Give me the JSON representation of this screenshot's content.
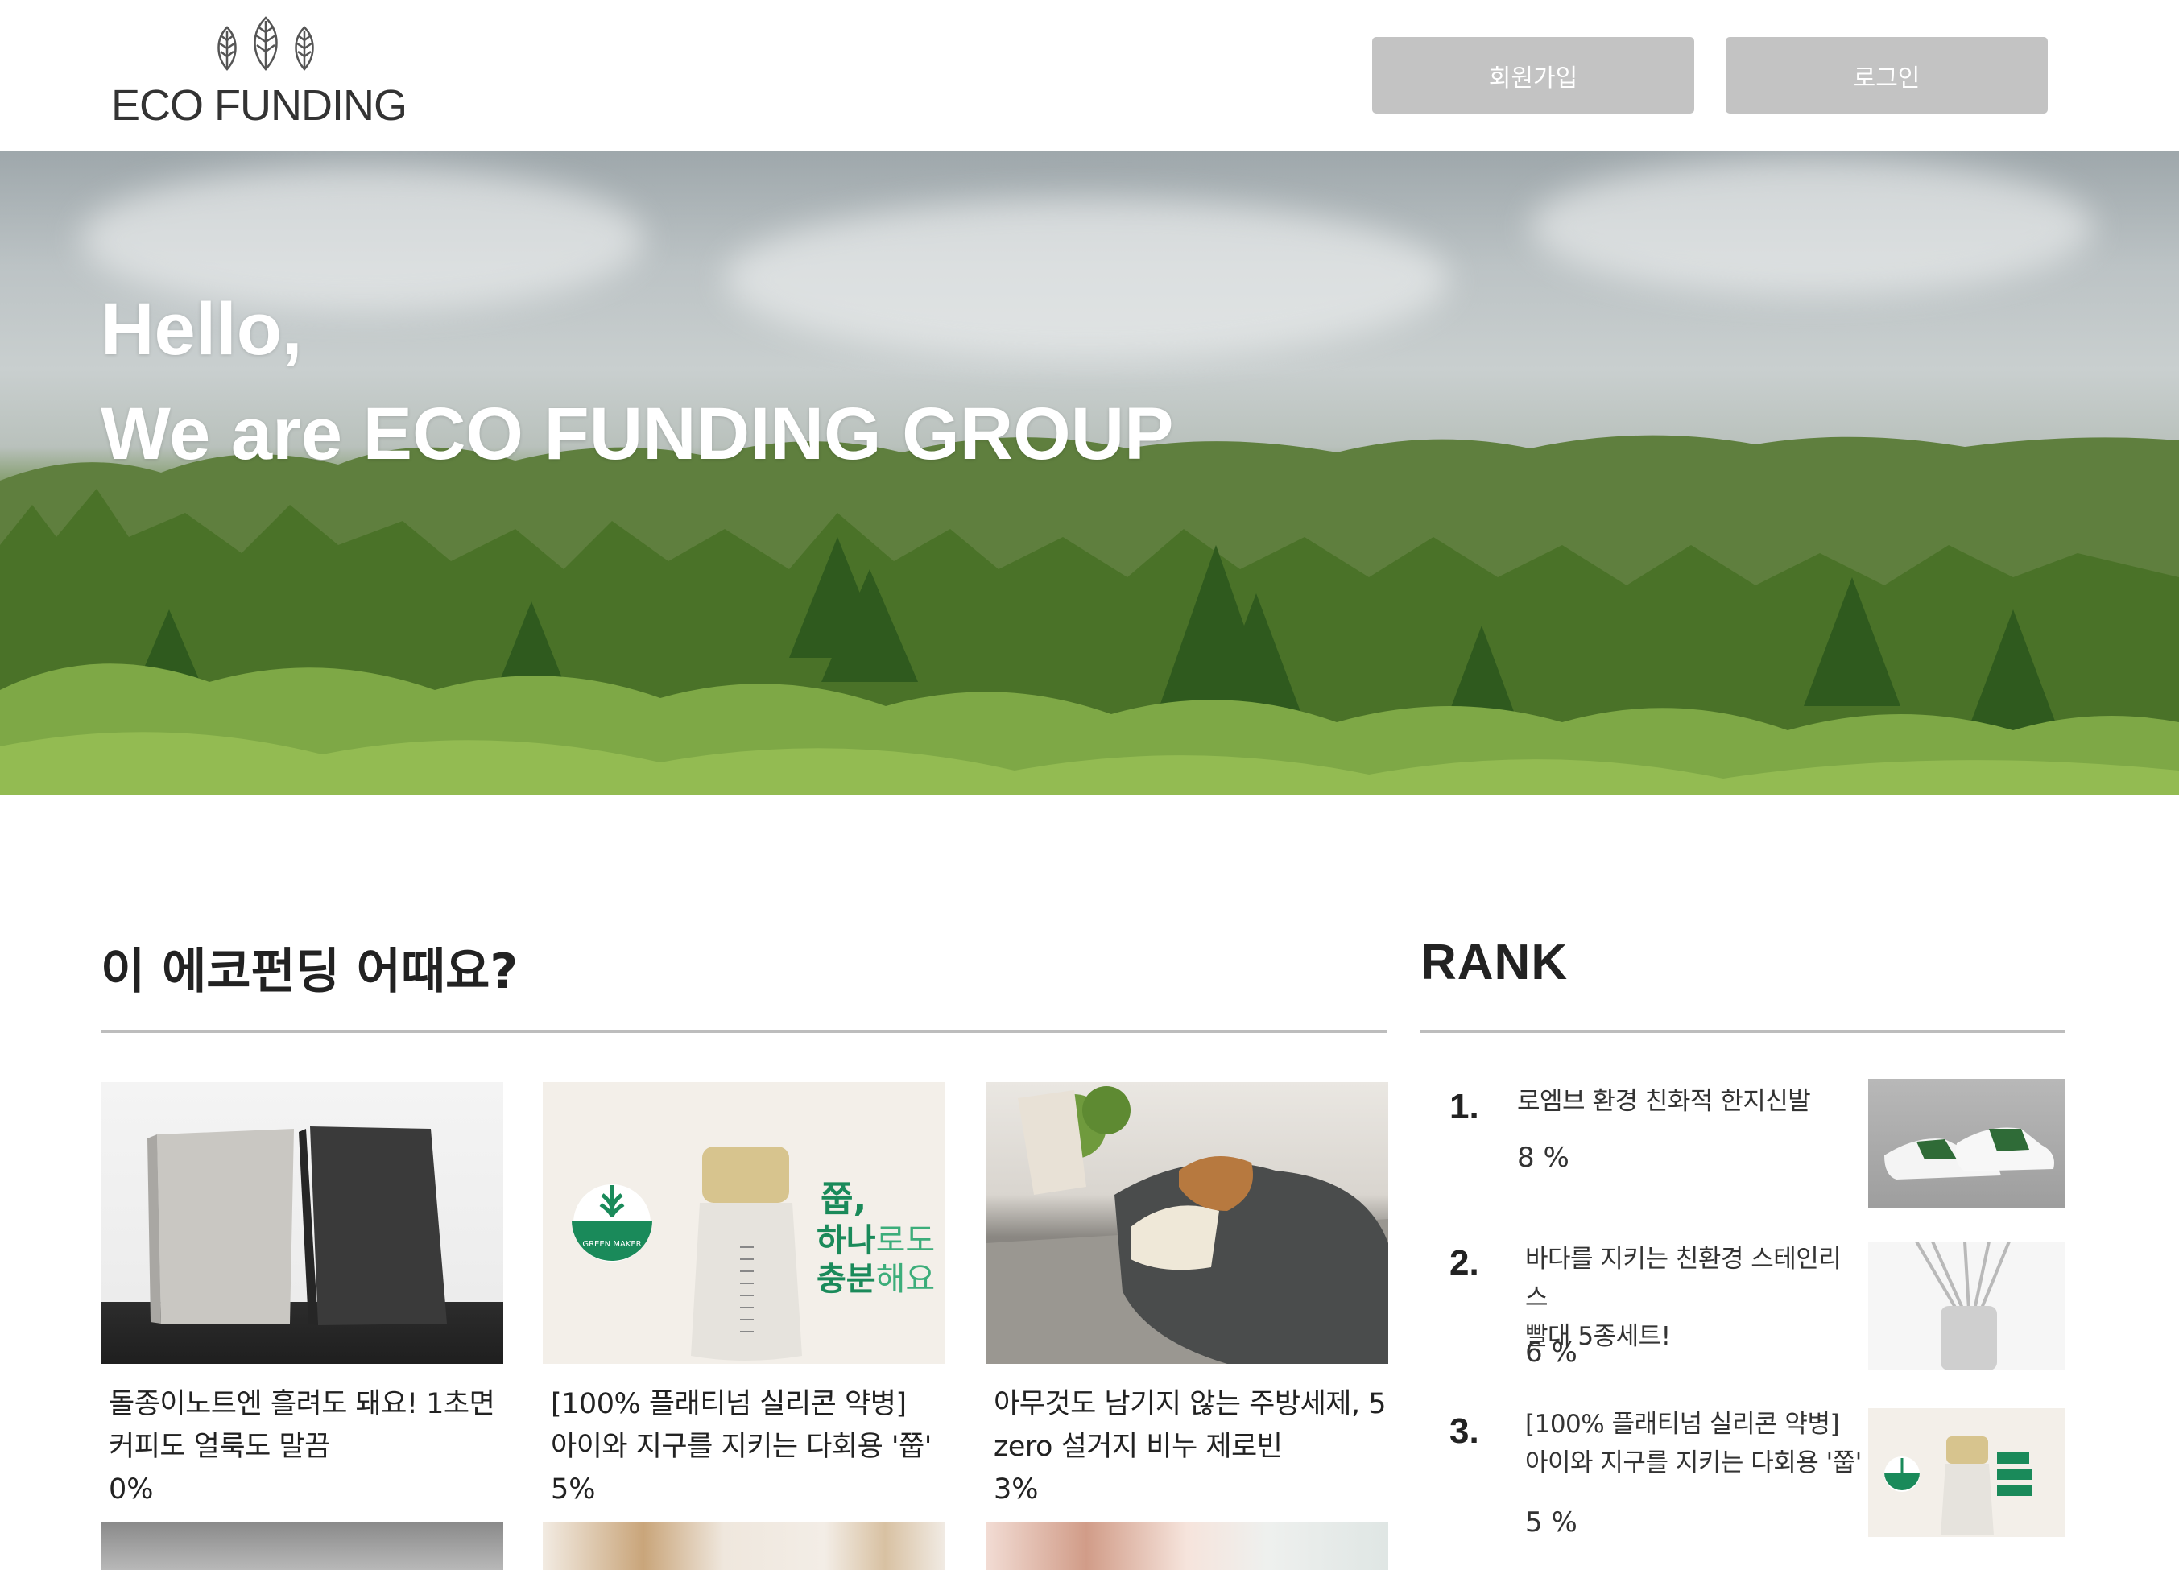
{
  "header": {
    "logo_text": "ECO FUNDING",
    "signup_label": "회원가입",
    "login_label": "로그인"
  },
  "hero": {
    "line1": "Hello,",
    "line2": "We are ECO FUNDING GROUP"
  },
  "recommend": {
    "title": "이 에코펀딩 어때요?",
    "cards": [
      {
        "title_line1": "돌종이노트엔 흘려도 돼요! 1초면",
        "title_line2": "커피도 얼룩도 말끔",
        "percent": "0%"
      },
      {
        "title_line1": "[100% 플래티넘 실리콘 약병]",
        "title_line2": "아이와 지구를 지키는 다회용 '쭙'",
        "percent": "5%"
      },
      {
        "title_line1": "아무것도 남기지 않는 주방세제, 5",
        "title_line2": "zero 설거지 비누 제로빈",
        "percent": "3%"
      }
    ],
    "bottle_badge": "GREEN MAKER",
    "bottle_slogan_line1": "쭙,",
    "bottle_slogan_line2a": "하나",
    "bottle_slogan_line2b": "로도",
    "bottle_slogan_line3a": "충분",
    "bottle_slogan_line3b": "해요"
  },
  "rank": {
    "title": "RANK",
    "items": [
      {
        "number": "1.",
        "title_line1": "로엠브 환경 친화적 한지신발",
        "title_line2": "",
        "percent": "8 %"
      },
      {
        "number": "2.",
        "title_line1": "바다를 지키는 친환경 스테인리스",
        "title_line2": "빨대 5종세트!",
        "percent": "6 %"
      },
      {
        "number": "3.",
        "title_line1": "[100% 플래티넘 실리콘 약병]",
        "title_line2": "아이와 지구를 지키는 다회용 '쭙'",
        "percent": "5 %"
      }
    ]
  },
  "colors": {
    "button_bg": "#c3c3c3",
    "brand_green": "#1a8a5a",
    "divider": "#bdbdbd"
  }
}
